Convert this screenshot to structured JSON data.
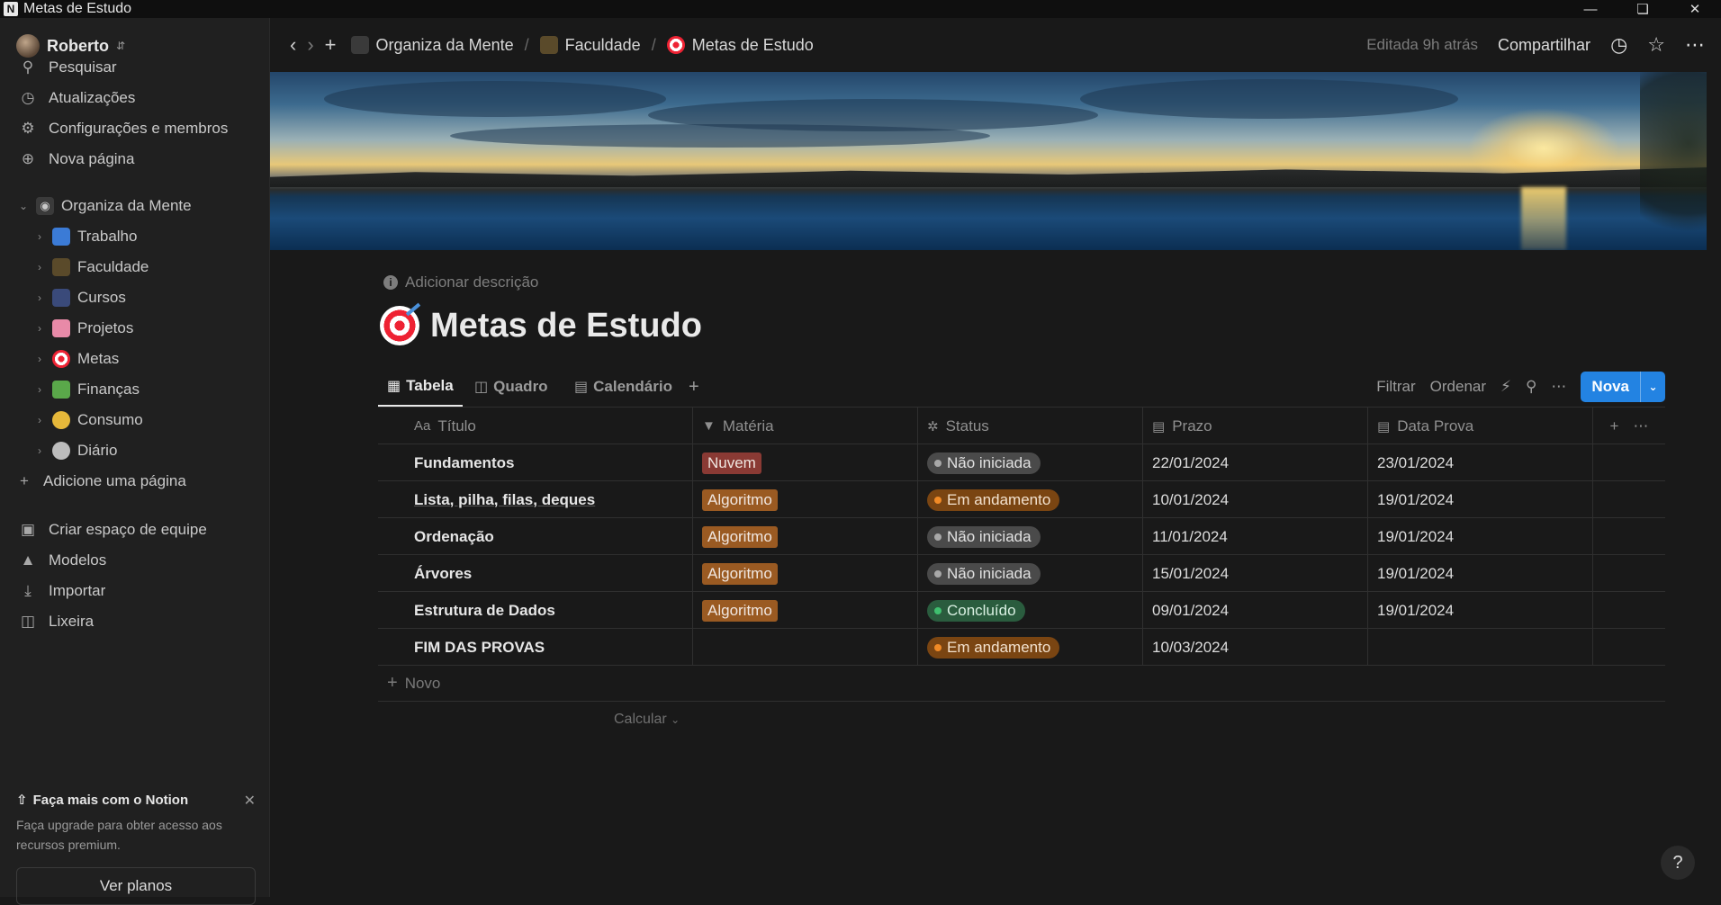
{
  "window": {
    "title": "Metas de Estudo",
    "app_icon": "N",
    "controls": [
      "minimize-icon",
      "restore-icon",
      "close-icon"
    ]
  },
  "sidebar": {
    "user": "Roberto",
    "top_items": [
      {
        "label": "Pesquisar",
        "icon": "search-icon"
      },
      {
        "label": "Atualizações",
        "icon": "clock-icon"
      },
      {
        "label": "Configurações e membros",
        "icon": "gear-icon"
      },
      {
        "label": "Nova página",
        "icon": "plus-circle-icon"
      }
    ],
    "workspace": {
      "label": "Organiza da Mente",
      "icon": "brain-emoji"
    },
    "pages": [
      {
        "label": "Trabalho",
        "icon": "laptop-emoji",
        "color": "#3b7bd6"
      },
      {
        "label": "Faculdade",
        "icon": "graduate-emoji",
        "color": "#c99b4a"
      },
      {
        "label": "Cursos",
        "icon": "wizard-emoji",
        "color": "#5a7fd0"
      },
      {
        "label": "Projetos",
        "icon": "brain-emoji",
        "color": "#e88aa8"
      },
      {
        "label": "Metas",
        "icon": "target-emoji",
        "color": "#e23"
      },
      {
        "label": "Finanças",
        "icon": "money-emoji",
        "color": "#5aa84a"
      },
      {
        "label": "Consumo",
        "icon": "nerd-face-emoji",
        "color": "#e6b83a"
      },
      {
        "label": "Diário",
        "icon": "alien-emoji",
        "color": "#bdbdbd"
      }
    ],
    "add_page": "Adicione uma página",
    "bottom_items": [
      {
        "label": "Criar espaço de equipe",
        "icon": "team-icon"
      },
      {
        "label": "Modelos",
        "icon": "templates-icon"
      },
      {
        "label": "Importar",
        "icon": "import-icon"
      },
      {
        "label": "Lixeira",
        "icon": "trash-icon"
      }
    ],
    "upsell": {
      "title": "Faça mais com o Notion",
      "description": "Faça upgrade para obter acesso aos recursos premium.",
      "button": "Ver planos"
    }
  },
  "topbar": {
    "breadcrumbs": [
      {
        "label": "Organiza da Mente",
        "icon": "brain-emoji"
      },
      {
        "label": "Faculdade",
        "icon": "graduate-emoji"
      },
      {
        "label": "Metas de Estudo",
        "icon": "target-emoji"
      }
    ],
    "edited": "Editada 9h atrás",
    "share": "Compartilhar"
  },
  "page": {
    "add_description": "Adicionar descrição",
    "title": "Metas de Estudo"
  },
  "views": {
    "tabs": [
      {
        "label": "Tabela",
        "icon": "table-icon",
        "active": true
      },
      {
        "label": "Quadro",
        "icon": "board-icon",
        "active": false
      },
      {
        "label": "Calendário",
        "icon": "calendar-icon",
        "active": false
      }
    ],
    "filter": "Filtrar",
    "sort": "Ordenar",
    "new_button": "Nova"
  },
  "table": {
    "columns": [
      {
        "label": "Título",
        "icon": "Aa"
      },
      {
        "label": "Matéria",
        "icon": "select-icon"
      },
      {
        "label": "Status",
        "icon": "status-icon"
      },
      {
        "label": "Prazo",
        "icon": "calendar-icon"
      },
      {
        "label": "Data Prova",
        "icon": "calendar-icon"
      }
    ],
    "rows": [
      {
        "title": "Fundamentos",
        "materia": "Nuvem",
        "status": "Não iniciada",
        "prazo": "22/01/2024",
        "prova": "23/01/2024"
      },
      {
        "title": "Lista, pilha, filas, deques",
        "materia": "Algoritmo",
        "status": "Em andamento",
        "prazo": "10/01/2024",
        "prova": "19/01/2024"
      },
      {
        "title": "Ordenação",
        "materia": "Algoritmo",
        "status": "Não iniciada",
        "prazo": "11/01/2024",
        "prova": "19/01/2024"
      },
      {
        "title": "Árvores",
        "materia": "Algoritmo",
        "status": "Não iniciada",
        "prazo": "15/01/2024",
        "prova": "19/01/2024"
      },
      {
        "title": "Estrutura de Dados",
        "materia": "Algoritmo",
        "status": "Concluído",
        "prazo": "09/01/2024",
        "prova": "19/01/2024"
      },
      {
        "title": "FIM DAS PROVAS",
        "materia": "",
        "status": "Em andamento",
        "prazo": "10/03/2024",
        "prova": ""
      }
    ],
    "add_row": "Novo",
    "calculate": "Calcular"
  },
  "colors": {
    "accent": "#2383e2",
    "tag_nuvem": "#8a3a34",
    "tag_algoritmo": "#9a5a22"
  }
}
